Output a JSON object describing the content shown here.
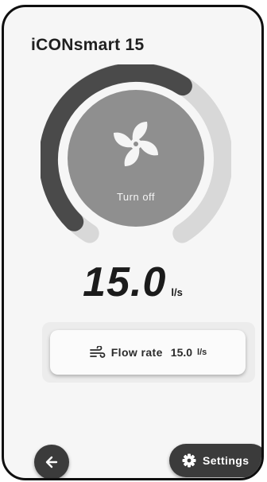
{
  "app": {
    "title": "iCONsmart 15"
  },
  "dial": {
    "button_label": "Turn off",
    "level_fraction": 0.62
  },
  "readout": {
    "value": "15.0",
    "unit": "l/s"
  },
  "flow": {
    "label": "Flow rate",
    "value": "15.0",
    "unit": "l/s"
  },
  "footer": {
    "settings_label": "Settings"
  },
  "icons": {
    "fan": "fan-icon",
    "wind": "wind-icon",
    "back": "arrow-left-icon",
    "settings": "gear-icon"
  }
}
